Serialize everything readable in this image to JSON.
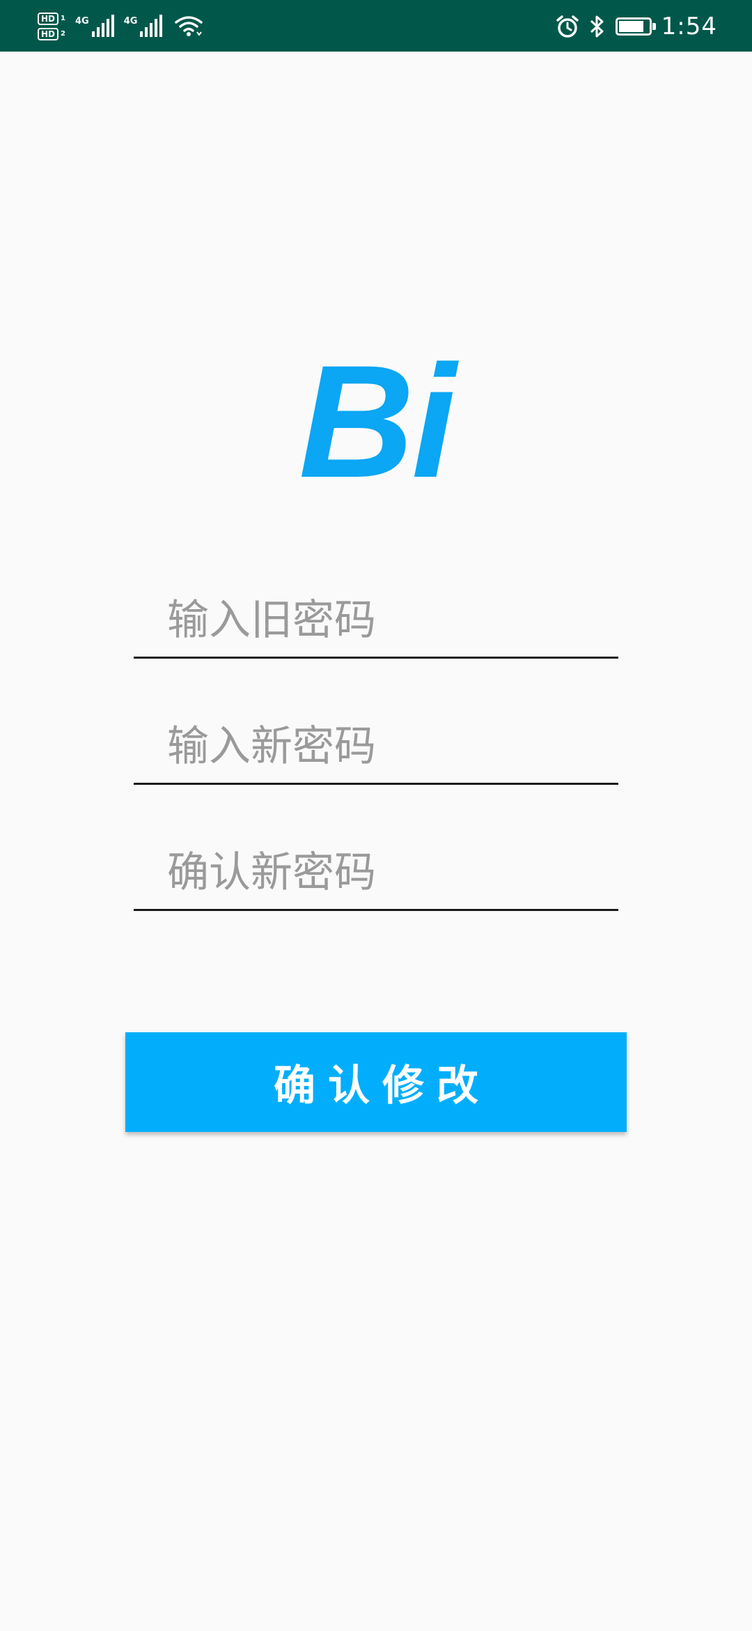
{
  "status_bar": {
    "sim1": {
      "badge": "HD",
      "index": "1",
      "network": "4G"
    },
    "sim2": {
      "badge": "HD",
      "index": "2",
      "network": "4G"
    },
    "time": "1:54",
    "battery_level": 0.85,
    "icons": [
      "signal-icon",
      "wifi-icon",
      "alarm-icon",
      "bluetooth-icon",
      "battery-charging-icon"
    ]
  },
  "logo": {
    "text": "Bi",
    "color": "#0ba6f4"
  },
  "form": {
    "old_password": {
      "value": "",
      "placeholder": "输入旧密码"
    },
    "new_password": {
      "value": "",
      "placeholder": "输入新密码"
    },
    "confirm_password": {
      "value": "",
      "placeholder": "确认新密码"
    }
  },
  "submit": {
    "label": "确认修改",
    "color": "#02aefc"
  },
  "colors": {
    "status_bar": "#01584a",
    "background": "#fafafa"
  }
}
